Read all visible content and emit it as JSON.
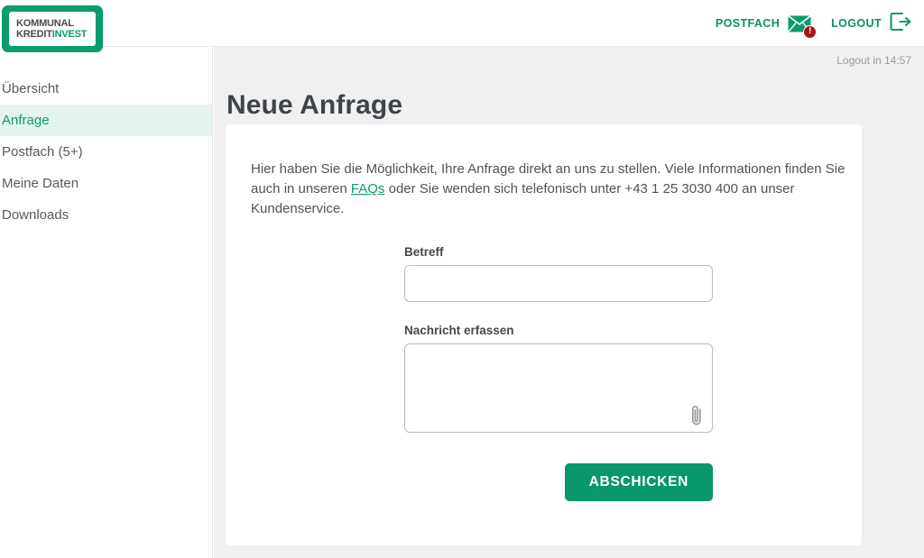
{
  "brand": {
    "logo_line1": "KOMMUNAL",
    "logo_line2_dark": "KREDIT",
    "logo_line2_accent": "INVEST",
    "accent_color": "#0a9b6e",
    "badge_color": "#a9121c"
  },
  "header": {
    "postfach_label": "POSTFACH",
    "postfach_icon": "envelope-icon",
    "postfach_badge": "!",
    "logout_label": "LOGOUT",
    "logout_icon": "logout-arrow-icon"
  },
  "sidebar": {
    "items": [
      {
        "label": "Übersicht",
        "active": false
      },
      {
        "label": "Anfrage",
        "active": true
      },
      {
        "label": "Postfach (5+)",
        "active": false
      },
      {
        "label": "Meine Daten",
        "active": false
      },
      {
        "label": "Downloads",
        "active": false
      }
    ]
  },
  "main": {
    "logout_timer": "Logout in 14:57",
    "page_title": "Neue Anfrage",
    "intro_part1": "Hier haben Sie die Möglichkeit, Ihre Anfrage direkt an uns zu stellen. Viele Informationen finden Sie auch in unseren ",
    "intro_link": "FAQs",
    "intro_part2": " oder Sie wenden sich telefonisch unter +43 1 25 3030 400 an unser Kundenservice."
  },
  "form": {
    "subject_label": "Betreff",
    "subject_value": "",
    "subject_placeholder": "",
    "message_label": "Nachricht erfassen",
    "message_value": "",
    "message_placeholder": "",
    "attachment_icon": "paperclip-icon",
    "submit_label": "ABSCHICKEN"
  }
}
